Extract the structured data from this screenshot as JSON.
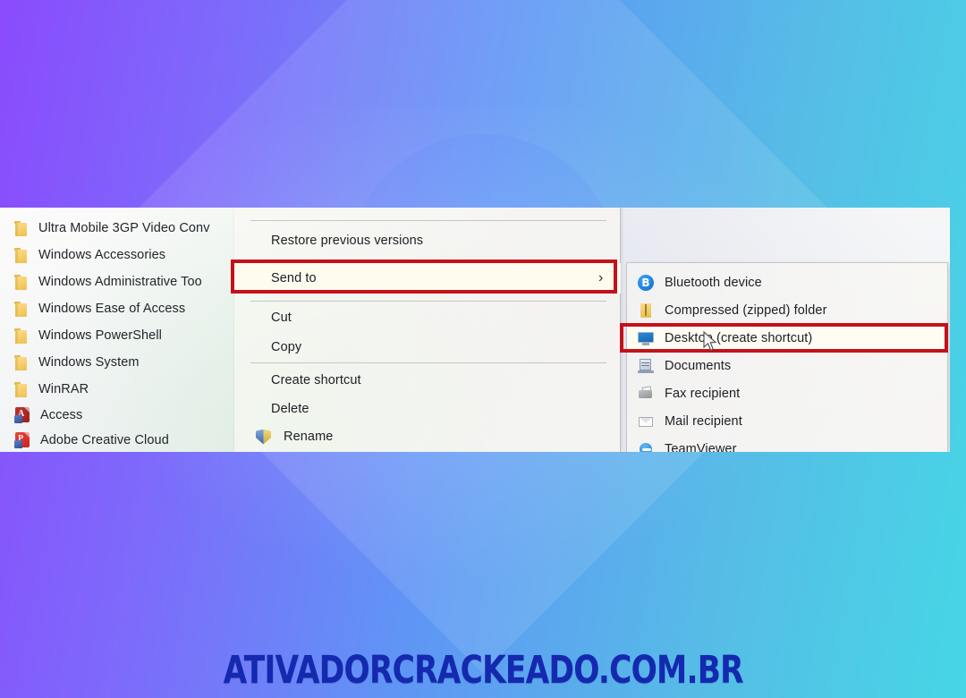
{
  "background": {
    "gradient_from": "#8a4bfc",
    "gradient_mid": "#5f96f5",
    "gradient_to": "#46d6e6",
    "watermark": "brazil-flag"
  },
  "applist": {
    "items": [
      {
        "label": "Ultra Mobile 3GP Video Conv",
        "icon": "folder-icon"
      },
      {
        "label": "Windows Accessories",
        "icon": "folder-icon"
      },
      {
        "label": "Windows Administrative Too",
        "icon": "folder-icon"
      },
      {
        "label": "Windows Ease of Access",
        "icon": "folder-icon"
      },
      {
        "label": "Windows PowerShell",
        "icon": "folder-icon"
      },
      {
        "label": "Windows System",
        "icon": "folder-icon"
      },
      {
        "label": "WinRAR",
        "icon": "folder-icon"
      },
      {
        "label": "Access",
        "icon": "ms-access-icon"
      },
      {
        "label": "Adobe Creative Cloud",
        "icon": "adobe-creative-cloud-icon"
      }
    ]
  },
  "context_menu": {
    "items": [
      {
        "label": "Restore previous versions",
        "icon": null,
        "submenu_arrow": false,
        "selected": false
      },
      {
        "label": "Send to",
        "icon": null,
        "submenu_arrow": true,
        "selected": true
      },
      {
        "label": "Cut",
        "icon": null,
        "submenu_arrow": false,
        "selected": false
      },
      {
        "label": "Copy",
        "icon": null,
        "submenu_arrow": false,
        "selected": false
      },
      {
        "label": "Create shortcut",
        "icon": null,
        "submenu_arrow": false,
        "selected": false
      },
      {
        "label": "Delete",
        "icon": null,
        "submenu_arrow": false,
        "selected": false
      },
      {
        "label": "Rename",
        "icon": "uac-shield-icon",
        "submenu_arrow": false,
        "selected": false
      }
    ],
    "submenu_arrow_glyph": "›"
  },
  "send_to_submenu": {
    "items": [
      {
        "label": "Bluetooth device",
        "icon": "bluetooth-icon",
        "selected": false
      },
      {
        "label": "Compressed (zipped) folder",
        "icon": "zipped-folder-icon",
        "selected": false
      },
      {
        "label": "Desktop (create shortcut)",
        "icon": "monitor-icon",
        "selected": true
      },
      {
        "label": "Documents",
        "icon": "documents-icon",
        "selected": false
      },
      {
        "label": "Fax recipient",
        "icon": "fax-icon",
        "selected": false
      },
      {
        "label": "Mail recipient",
        "icon": "mail-icon",
        "selected": false
      },
      {
        "label": "TeamViewer",
        "icon": "teamviewer-icon",
        "selected": false
      }
    ],
    "bluetooth_glyph": "B"
  },
  "annotations": {
    "color": "#c4121a",
    "boxes": [
      {
        "name": "send-to-highlight",
        "target": "Send to"
      },
      {
        "name": "desktop-create-shortcut-highlight",
        "target": "Desktop (create shortcut)"
      }
    ]
  },
  "footer": {
    "watermark_text": "ATIVADORCRACKEADO.COM.BR",
    "color": "#1429b0"
  }
}
